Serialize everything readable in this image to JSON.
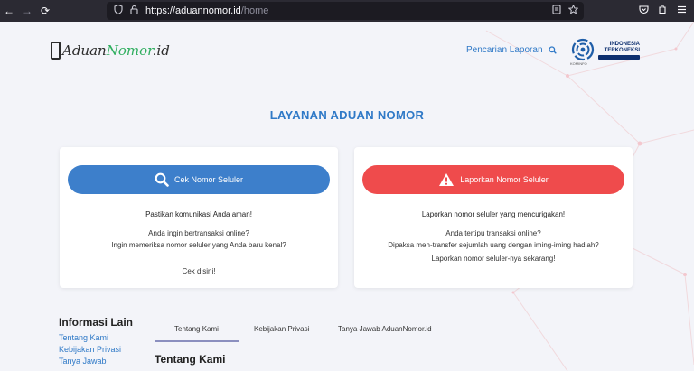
{
  "browser": {
    "back_icon": "←",
    "forward_icon": "→",
    "reload_icon": "⟳",
    "url_host": "https://aduannomor.id",
    "url_path": "/home"
  },
  "header": {
    "logo_part1": "Aduan",
    "logo_part2": "Nomor",
    "logo_part3": ".id",
    "search_label": "Pencarian Laporan",
    "kominfo_label": "KOMINFO",
    "badge_line1": "INDONESIA",
    "badge_line2": "TERKONEKSI"
  },
  "section": {
    "title": "LAYANAN ADUAN NOMOR"
  },
  "cards": [
    {
      "button_label": "Cek Nomor Seluler",
      "headline": "Pastikan komunikasi Anda aman!",
      "line1": "Anda ingin bertransaksi online?",
      "line2": "Ingin memeriksa nomor seluler yang Anda baru kenal?",
      "line3": "Cek disini!"
    },
    {
      "button_label": "Laporkan Nomor Seluler",
      "headline": "Laporkan nomor seluler yang mencurigakan!",
      "line1": "Anda tertipu transaksi online?",
      "line2": "Dipaksa men-transfer sejumlah uang dengan iming-iming hadiah?",
      "line3": "Laporkan nomor seluler-nya sekarang!"
    }
  ],
  "info": {
    "title": "Informasi Lain",
    "links": [
      "Tentang Kami",
      "Kebijakan Privasi",
      "Tanya Jawab"
    ]
  },
  "tabs": {
    "items": [
      "Tentang Kami",
      "Kebijakan Privasi",
      "Tanya Jawab AduanNomor.id"
    ],
    "content_title": "Tentang Kami"
  },
  "colors": {
    "primary": "#2f79c7",
    "check_button": "#3d7fcb",
    "report_button": "#ef4b4c",
    "page_bg": "#f3f4f9"
  }
}
